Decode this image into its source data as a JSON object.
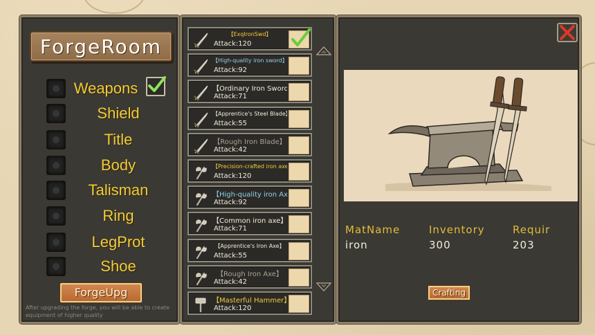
{
  "forge_room": {
    "title": "ForgeRoom",
    "categories": [
      {
        "label": "Weapons",
        "selected": true
      },
      {
        "label": "Shield",
        "selected": false
      },
      {
        "label": "Title",
        "selected": false
      },
      {
        "label": "Body",
        "selected": false
      },
      {
        "label": "Talisman",
        "selected": false
      },
      {
        "label": "Ring",
        "selected": false
      },
      {
        "label": "LegProt",
        "selected": false
      },
      {
        "label": "Shoe",
        "selected": false
      }
    ],
    "forge_upgrade_label": "ForgeUpg",
    "hint_text": "After upgrading the forge, you will be able to create equipment of higher quality"
  },
  "equipment_list": {
    "items": [
      {
        "name": "【ExqIronSwd】",
        "attack": "Attack:120",
        "icon": "sword-icon",
        "selected": true
      },
      {
        "name": "【High-quality iron sword】",
        "attack": "Attack:92",
        "icon": "sword-icon",
        "selected": false
      },
      {
        "name": "【Ordinary Iron Sword】",
        "attack": "Attack:71",
        "icon": "sword-icon",
        "selected": false
      },
      {
        "name": "【Apprentice's Steel Blade】",
        "attack": "Attack:55",
        "icon": "sword-icon",
        "selected": false
      },
      {
        "name": "【Rough Iron Blade】",
        "attack": "Attack:42",
        "icon": "sword-icon",
        "selected": false
      },
      {
        "name": "【Precision-crafted iron axe】",
        "attack": "Attack:120",
        "icon": "axe-icon",
        "selected": false
      },
      {
        "name": "【High-quality iron Axe】",
        "attack": "Attack:92",
        "icon": "axe-icon",
        "selected": false
      },
      {
        "name": "【Common iron axe】",
        "attack": "Attack:71",
        "icon": "axe-icon",
        "selected": false
      },
      {
        "name": "【Apprentice's Iron Axe】",
        "attack": "Attack:55",
        "icon": "axe-icon",
        "selected": false
      },
      {
        "name": "【Rough Iron Axe】",
        "attack": "Attack:42",
        "icon": "axe-icon",
        "selected": false
      },
      {
        "name": "【Masterful Hammer】",
        "attack": "Attack:120",
        "icon": "hammer-icon",
        "selected": false
      }
    ]
  },
  "detail": {
    "materials": {
      "headers": [
        "MatName",
        "Inventory",
        "Requir"
      ],
      "row": [
        "iron",
        "300",
        "203"
      ]
    },
    "crafting_label": "Crafting"
  },
  "colors": {
    "label_gold": "#f2cb3b",
    "button_orange": "#c47a40",
    "panel_bg": "#3b3934",
    "parchment": "#e6d6b4"
  }
}
